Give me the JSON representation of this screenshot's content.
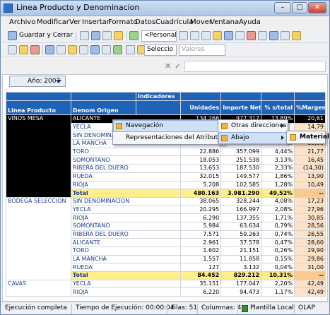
{
  "window": {
    "title": "Linea Producto y Denominacion",
    "controls": [
      "–",
      "□",
      "✕"
    ]
  },
  "menubar": [
    "Archivo",
    "Modificar",
    "Ver",
    "Insertar",
    "Formato",
    "Datos",
    "Cuadrícula",
    "Mover",
    "Ventana",
    "Ayuda"
  ],
  "toolbar1": {
    "save_close": "Guardar y Cerrar",
    "personal": "<Personal"
  },
  "toolbar2": {
    "selection": "Seleccio",
    "values": "Valores"
  },
  "formula": {
    "cancel_symbol": "✕",
    "accept_symbol": "✓"
  },
  "filter": {
    "year": "Año: 2007"
  },
  "grid": {
    "header_indicators": "Indicadores",
    "col_product": "Linea Producto",
    "col_denom": "Denom Origen",
    "col_units": "Unidades",
    "col_net": "Importe Neto",
    "col_pct": "% s/total",
    "col_margin": "%Margen",
    "groups": [
      {
        "product": "VINOS MESA",
        "rows": [
          [
            "ALICANTE",
            "134.266",
            "977.317",
            "13,89%",
            "20,61"
          ],
          [
            "YECLA",
            "",
            "",
            "",
            "14,79"
          ],
          [
            "SIN DENOMINA",
            "",
            "",
            "",
            "17,94"
          ],
          [
            "LA MANCHA",
            "27.928",
            "420.908",
            "5,23%",
            "18,98"
          ],
          [
            "TORO",
            "22.886",
            "357.099",
            "4,44%",
            "21,77"
          ],
          [
            "SOMONTANO",
            "18.053",
            "251.538",
            "3,13%",
            "16,45"
          ],
          [
            "RIBERA DEL DUERO",
            "13.653",
            "187.530",
            "2,33%",
            "(14,30)"
          ],
          [
            "RUEDA",
            "32.015",
            "149.577",
            "1,86%",
            "13,90"
          ],
          [
            "RIOJA",
            "5.208",
            "102.585",
            "1,28%",
            "10,49"
          ]
        ],
        "total": [
          "Total",
          "480.163",
          "3.981.290",
          "49,52%",
          "--"
        ]
      },
      {
        "product": "BODEGA SELECCION",
        "rows": [
          [
            "SIN DENOMINACION",
            "38.065",
            "328.244",
            "4,08%",
            "17,23"
          ],
          [
            "YECLA",
            "20.295",
            "166.997",
            "2,08%",
            "27,96"
          ],
          [
            "RIOJA",
            "6.290",
            "137.355",
            "1,71%",
            "30,85"
          ],
          [
            "SOMONTANO",
            "5.984",
            "63.634",
            "0,79%",
            "28,56"
          ],
          [
            "RIBERA DEL DUERO",
            "7.571",
            "59.263",
            "0,74%",
            "26,55"
          ],
          [
            "ALICANTE",
            "2.961",
            "37.578",
            "0,47%",
            "28,60"
          ],
          [
            "TORO",
            "1.602",
            "21.151",
            "0,26%",
            "29,90"
          ],
          [
            "LA MANCHA",
            "1.557",
            "11.858",
            "0,15%",
            "29,86"
          ],
          [
            "RUEDA",
            "127",
            "3.132",
            "0,04%",
            "31,00"
          ]
        ],
        "total": [
          "Total",
          "84.452",
          "829.212",
          "10,31%",
          "--"
        ]
      },
      {
        "product": "CAVAS",
        "rows": [
          [
            "YECLA",
            "35.151",
            "177.047",
            "2,20%",
            "42,49"
          ],
          [
            "RIOJA",
            "6.220",
            "94.473",
            "1,17%",
            "42,49"
          ]
        ]
      }
    ]
  },
  "context_menu": {
    "items": [
      "Navegación",
      "Representaciones del Atributo"
    ]
  },
  "submenu1": {
    "items": [
      "Otras direcciones",
      "Abajo"
    ]
  },
  "submenu2": {
    "items": [
      "Material"
    ]
  },
  "status": {
    "state": "Ejecución completa",
    "time": "Tiempo de Ejecución: 00:00:04",
    "rows": "Filas: 51",
    "cols": "Columnas: 4",
    "template": "Plantilla Local",
    "mode": "OLAP"
  },
  "colors": {
    "header": "#1f63b8",
    "total_row": "#ffee8a",
    "margin_col": "#fde2c8",
    "menu_highlight": "#cfe0f7"
  }
}
